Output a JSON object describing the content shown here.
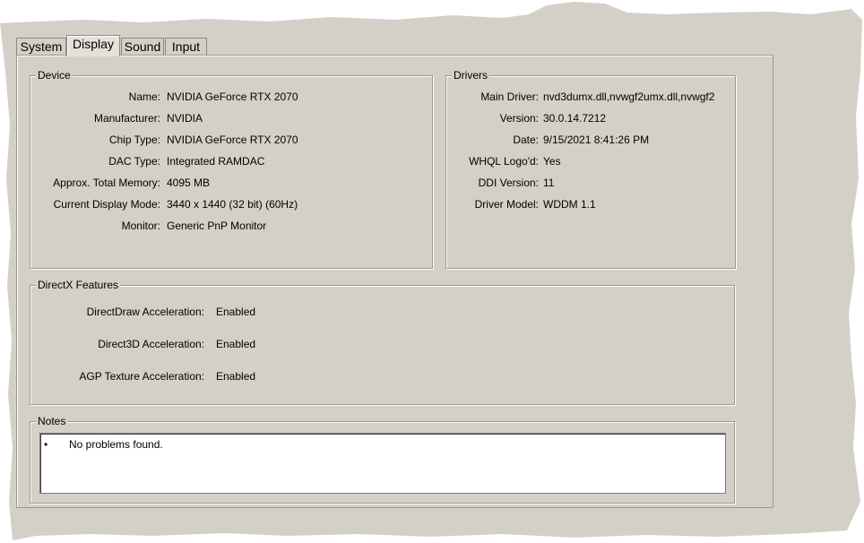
{
  "tabs": [
    {
      "label": "System",
      "active": false
    },
    {
      "label": "Display",
      "active": true
    },
    {
      "label": "Sound",
      "active": false
    },
    {
      "label": "Input",
      "active": false
    }
  ],
  "device": {
    "title": "Device",
    "fields": [
      {
        "label": "Name:",
        "value": "NVIDIA GeForce RTX 2070"
      },
      {
        "label": "Manufacturer:",
        "value": "NVIDIA"
      },
      {
        "label": "Chip Type:",
        "value": "NVIDIA GeForce RTX 2070"
      },
      {
        "label": "DAC Type:",
        "value": "Integrated RAMDAC"
      },
      {
        "label": "Approx. Total Memory:",
        "value": "4095 MB"
      },
      {
        "label": "Current Display Mode:",
        "value": "3440 x 1440 (32 bit) (60Hz)"
      },
      {
        "label": "Monitor:",
        "value": "Generic PnP Monitor"
      }
    ]
  },
  "drivers": {
    "title": "Drivers",
    "fields": [
      {
        "label": "Main Driver:",
        "value": "nvd3dumx.dll,nvwgf2umx.dll,nvwgf2"
      },
      {
        "label": "Version:",
        "value": "30.0.14.7212"
      },
      {
        "label": "Date:",
        "value": "9/15/2021 8:41:26 PM"
      },
      {
        "label": "WHQL Logo'd:",
        "value": "Yes"
      },
      {
        "label": "DDI Version:",
        "value": "11"
      },
      {
        "label": "Driver Model:",
        "value": "WDDM 1.1"
      }
    ]
  },
  "directx": {
    "title": "DirectX Features",
    "fields": [
      {
        "label": "DirectDraw Acceleration:",
        "value": "Enabled"
      },
      {
        "label": "Direct3D Acceleration:",
        "value": "Enabled"
      },
      {
        "label": "AGP Texture Acceleration:",
        "value": "Enabled"
      }
    ]
  },
  "notes": {
    "title": "Notes",
    "bullet": "•",
    "items": [
      "No problems found."
    ]
  },
  "colors": {
    "dialog_background": "#d4d0c8",
    "notes_background": "#ffffff"
  }
}
